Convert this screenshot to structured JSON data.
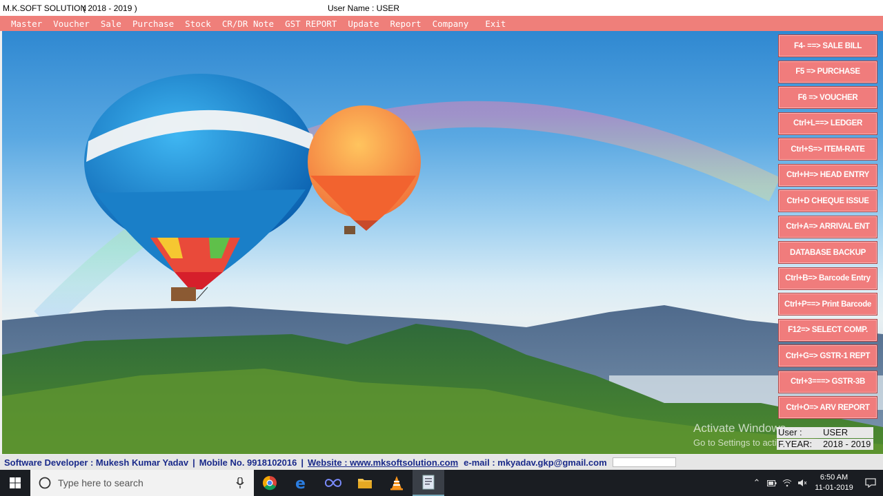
{
  "titlebar": {
    "app": "M.K.SOFT SOLUTION",
    "year": "( 2018 - 2019 )",
    "user": "User Name : USER"
  },
  "menu": [
    "Master",
    "Voucher",
    "Sale",
    "Purchase",
    "Stock",
    "CR/DR Note",
    "GST REPORT",
    "Update",
    "Report",
    "Company",
    "Exit"
  ],
  "fkeys": [
    "F4- ==> SALE BILL",
    "F5 => PURCHASE",
    "F6 => VOUCHER",
    "Ctrl+L==> LEDGER",
    "Ctrl+S=> ITEM-RATE",
    "Ctrl+H=> HEAD ENTRY",
    "Ctrl+D CHEQUE ISSUE",
    "Ctrl+A=> ARRIVAL ENT",
    "DATABASE BACKUP",
    "Ctrl+B=> Barcode Entry",
    "Ctrl+P==> Print Barcode",
    "F12=> SELECT COMP.",
    "Ctrl+G=> GSTR-1 REPT",
    "Ctrl+3===> GSTR-3B",
    "Ctrl+O=> ARV REPORT"
  ],
  "watermark": {
    "line1": "Activate Windows",
    "line2": "Go to Settings to activate Windows."
  },
  "userinfo": {
    "user_label": "User :",
    "user_value": "USER",
    "fyear_label": "F.YEAR:",
    "fyear_value": "2018 - 2019"
  },
  "footer": {
    "developer": "Software Developer : Mukesh Kumar Yadav",
    "mobile": "Mobile No. 9918102016",
    "website": "Website : www.mksoftsolution.com",
    "email": "e-mail : mkyadav.gkp@gmail.com"
  },
  "taskbar": {
    "search_placeholder": "Type here to search",
    "time": "6:50 AM",
    "date": "11-01-2019",
    "apps": [
      "chrome-icon",
      "edge-icon",
      "infinity-icon",
      "file-explorer-icon",
      "vlc-icon",
      "document-app-icon"
    ]
  }
}
